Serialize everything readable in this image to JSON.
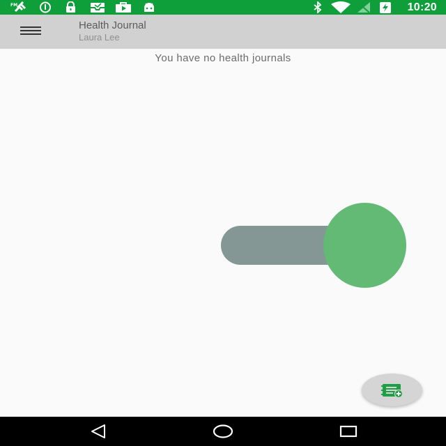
{
  "status_bar": {
    "time": "10:20",
    "background": "#0f9f3a",
    "left_icons": [
      "satellite-icon",
      "info-icon",
      "lock-icon",
      "inbox-icon",
      "play-store-icon",
      "android-icon"
    ],
    "right_icons": [
      "bluetooth-icon",
      "wifi-icon",
      "no-signal-icon",
      "battery-charging-icon"
    ]
  },
  "app_bar": {
    "title": "Health Journal",
    "subtitle": "Laura Lee",
    "menu_icon": "hamburger-menu-icon",
    "background": "#d1d1d1"
  },
  "content": {
    "empty_message": "You have no health journals"
  },
  "toggle": {
    "state": "on",
    "track_color": "#859794",
    "thumb_color": "#62ba74"
  },
  "fab": {
    "icon": "add-journal-icon",
    "icon_color": "#1e9e45"
  },
  "nav_bar": {
    "buttons": [
      "back-icon",
      "home-icon",
      "recents-icon"
    ]
  }
}
